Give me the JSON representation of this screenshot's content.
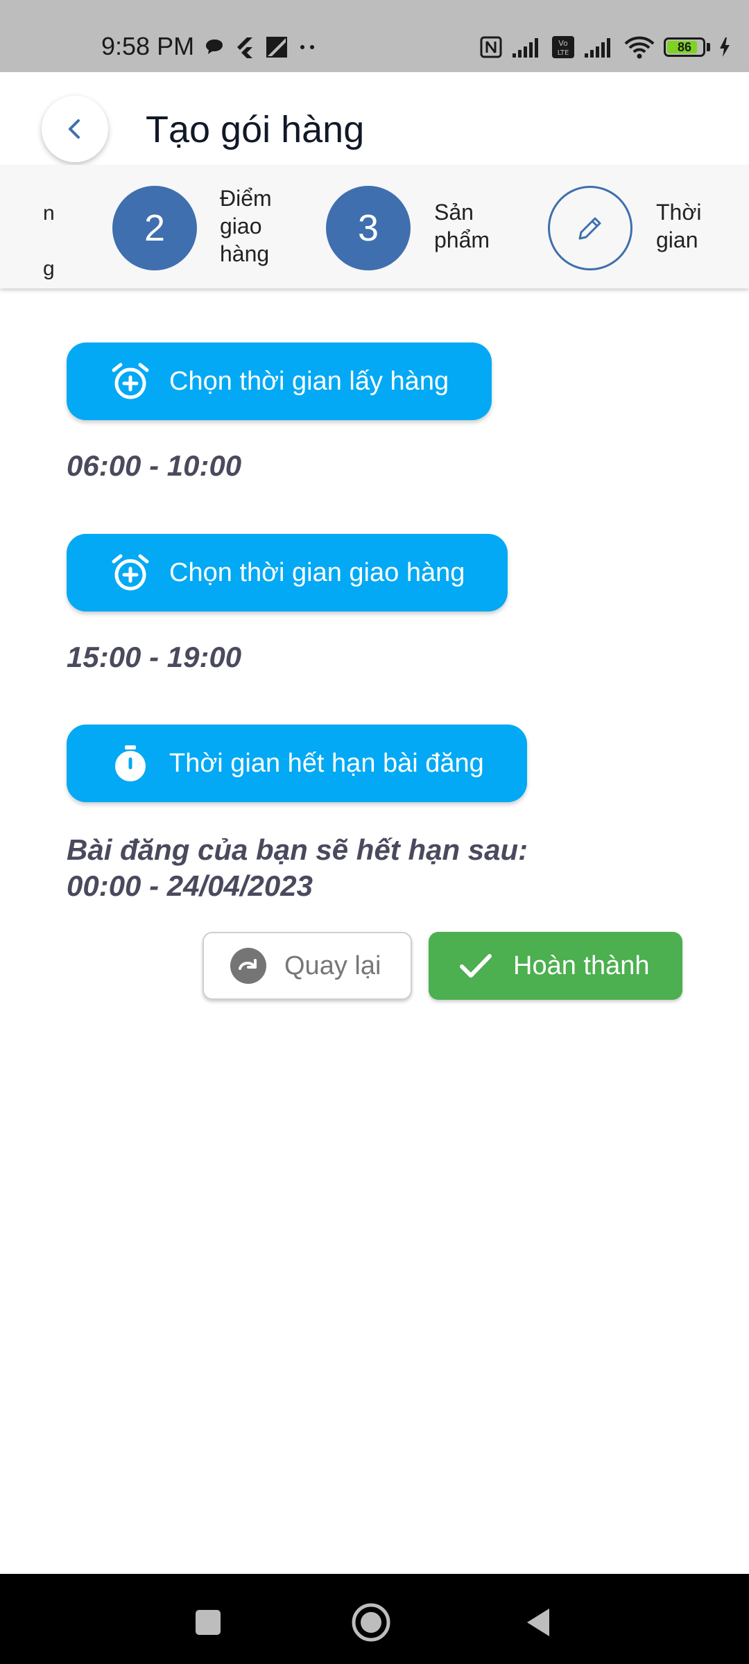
{
  "status_bar": {
    "time": "9:58 PM",
    "battery_level": "86",
    "icons_left": [
      "chat-bubble-icon",
      "flutter-icon",
      "image-icon",
      "more-dots-icon"
    ],
    "icons_right": [
      "nfc-icon",
      "signal-icon",
      "volte-icon",
      "signal-icon",
      "wifi-icon",
      "battery-icon",
      "charging-icon"
    ]
  },
  "app_bar": {
    "title": "Tạo gói hàng"
  },
  "stepper": {
    "partial_step_lines": [
      "n",
      "g"
    ],
    "steps": [
      {
        "number": "2",
        "label_lines": [
          "Điểm",
          "giao",
          "hàng"
        ]
      },
      {
        "number": "3",
        "label_lines": [
          "Sản",
          "phẩm"
        ]
      },
      {
        "icon": "pencil-icon",
        "label_lines": [
          "Thời",
          "gian"
        ]
      }
    ]
  },
  "pickup": {
    "button_label": "Chọn thời gian lấy hàng",
    "time_range": "06:00 - 10:00"
  },
  "delivery": {
    "button_label": "Chọn thời gian giao hàng",
    "time_range": "15:00 - 19:00"
  },
  "expiry": {
    "button_label": "Thời gian hết hạn bài đăng",
    "text_line1": "Bài đăng của bạn sẽ hết hạn sau:",
    "text_line2": "00:00 - 24/04/2023"
  },
  "actions": {
    "back_label": "Quay lại",
    "done_label": "Hoàn thành"
  },
  "colors": {
    "primary": "#03a9f4",
    "step_blue": "#3f6fae",
    "success": "#4caf50",
    "text_muted": "#4a4a5e"
  }
}
